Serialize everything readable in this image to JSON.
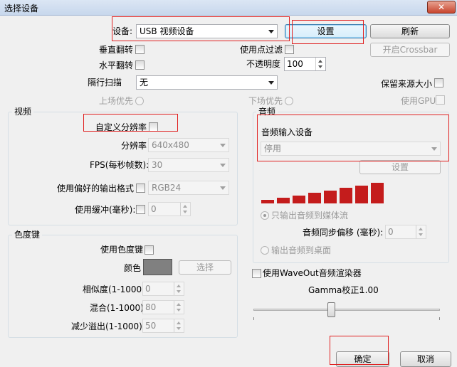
{
  "window": {
    "title": "选择设备",
    "close_glyph": "✕"
  },
  "device": {
    "label": "设备:",
    "selected": "USB 视频设备",
    "settings_button": "设置",
    "refresh_button": "刷新",
    "crossbar_button": "开启Crossbar"
  },
  "options": {
    "flip_vertical": "垂直翻转",
    "flip_horizontal": "水平翻转",
    "use_point_filter": "使用点过滤",
    "opacity_label": "不透明度",
    "opacity_value": "100",
    "deinterlace_label": "隔行扫描",
    "deinterlace_value": "无",
    "keep_source_size": "保留来源大小",
    "upper_field_first": "上场优先",
    "lower_field_first": "下场优先",
    "use_gpu": "使用GPU"
  },
  "video": {
    "group_title": "视频",
    "custom_resolution": "自定义分辨率",
    "resolution_label": "分辨率",
    "resolution_value": "640x480",
    "fps_label": "FPS(每秒帧数):",
    "fps_value": "30",
    "preferred_format_label": "使用偏好的输出格式",
    "preferred_format_value": "RGB24",
    "buffer_label": "使用缓冲(毫秒):",
    "buffer_value": "0"
  },
  "chroma": {
    "group_title": "色度键",
    "use_chroma": "使用色度键",
    "color_label": "颜色",
    "color_value": "#808080",
    "select_button": "选择",
    "similarity_label": "相似度(1-1000):",
    "similarity_value": "0",
    "blend_label": "混合(1-1000):",
    "blend_value": "80",
    "spill_label": "减少溢出(1-1000):",
    "spill_value": "50"
  },
  "audio": {
    "group_title": "音频",
    "input_device_label": "音频输入设备",
    "input_device_value": "停用",
    "settings_button": "设置",
    "level_bar_color": "#c41c1c",
    "output_stream_only": "只输出音频到媒体流",
    "sync_offset_label": "音频同步偏移 (毫秒):",
    "sync_offset_value": "0",
    "output_to_desktop": "输出音频到桌面",
    "use_waveout": "使用WaveOut音频渲染器",
    "gamma_label": "Gamma校正:",
    "gamma_value": "1.00"
  },
  "footer": {
    "ok_button": "确定",
    "cancel_button": "取消"
  },
  "accent_colors": {
    "highlight_box": "#e02020"
  }
}
